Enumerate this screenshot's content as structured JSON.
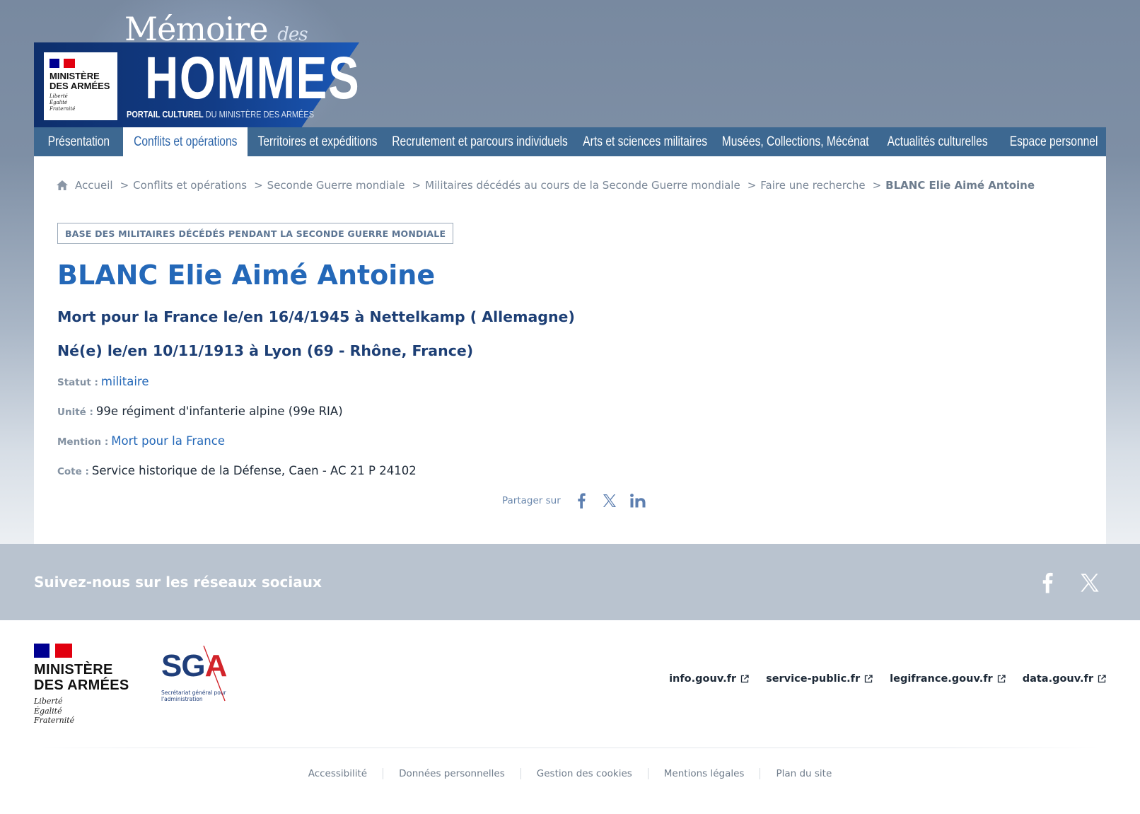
{
  "brand": {
    "memoire": "Mémoire",
    "des": "des",
    "hommes": "HOMMES",
    "portail_bold": "PORTAIL CULTUREL",
    "portail_light": "DU MINISTÈRE DES ARMÉES",
    "ministry_name": "MINISTÈRE DES ARMÉES",
    "motto": [
      "Liberté",
      "Égalité",
      "Fraternité"
    ]
  },
  "nav": {
    "items": [
      {
        "label": "Présentation"
      },
      {
        "label": "Conflits et opérations"
      },
      {
        "label": "Territoires et expéditions"
      },
      {
        "label": "Recrutement et parcours individuels"
      },
      {
        "label": "Arts et sciences militaires"
      },
      {
        "label": "Musées, Collections, Mécénat"
      },
      {
        "label": "Actualités culturelles"
      },
      {
        "label": "Espace personnel"
      }
    ],
    "active": "Conflits et opérations"
  },
  "breadcrumb": {
    "items": [
      {
        "label": "Accueil"
      },
      {
        "label": "Conflits et opérations"
      },
      {
        "label": "Seconde Guerre mondiale"
      },
      {
        "label": "Militaires décédés au cours de la Seconde Guerre mondiale"
      },
      {
        "label": "Faire une recherche"
      }
    ],
    "current": "BLANC Elie Aimé Antoine",
    "separator": ">"
  },
  "record": {
    "database_tag": "BASE DES MILITAIRES DÉCÉDÉS PENDANT LA SECONDE GUERRE MONDIALE",
    "name": "BLANC Elie Aimé Antoine",
    "death_line": "Mort pour la France le/en 16/4/1945 à Nettelkamp ( Allemagne)",
    "birth_line": "Né(e) le/en 10/11/1913 à Lyon (69 - Rhône, France)",
    "fields": {
      "statut": {
        "label": "Statut :",
        "value": "militaire"
      },
      "unite": {
        "label": "Unité :",
        "value": "99e régiment d'infanterie alpine (99e RIA)"
      },
      "mention": {
        "label": "Mention :",
        "value": "Mort pour la France"
      },
      "cote": {
        "label": "Cote :",
        "value": "Service historique de la Défense, Caen - AC 21 P 24102"
      }
    }
  },
  "share": {
    "label": "Partager sur",
    "icons": [
      "facebook-icon",
      "x-icon",
      "linkedin-icon"
    ]
  },
  "social": {
    "title": "Suivez-nous sur les réseaux sociaux",
    "icons": [
      "facebook-icon",
      "x-icon"
    ]
  },
  "footer": {
    "ministry_name": "MINISTÈRE DES ARMÉES",
    "motto": [
      "Liberté",
      "Égalité",
      "Fraternité"
    ],
    "sga": {
      "letters_sg": "SG",
      "letters_a": "A",
      "subtitle": "Secrétariat général pour l'administration"
    },
    "external_links": [
      {
        "label": "info.gouv.fr"
      },
      {
        "label": "service-public.fr"
      },
      {
        "label": "legifrance.gouv.fr"
      },
      {
        "label": "data.gouv.fr"
      }
    ],
    "legal_links": [
      {
        "label": "Accessibilité"
      },
      {
        "label": "Données personnelles"
      },
      {
        "label": "Gestion des cookies"
      },
      {
        "label": "Mentions légales"
      },
      {
        "label": "Plan du site"
      }
    ]
  },
  "colors": {
    "nav_bg": "#3d6891",
    "accent_blue": "#2468b8",
    "heading_navy": "#1d3f75",
    "flag_blue": "#000091",
    "flag_red": "#e1000f"
  }
}
